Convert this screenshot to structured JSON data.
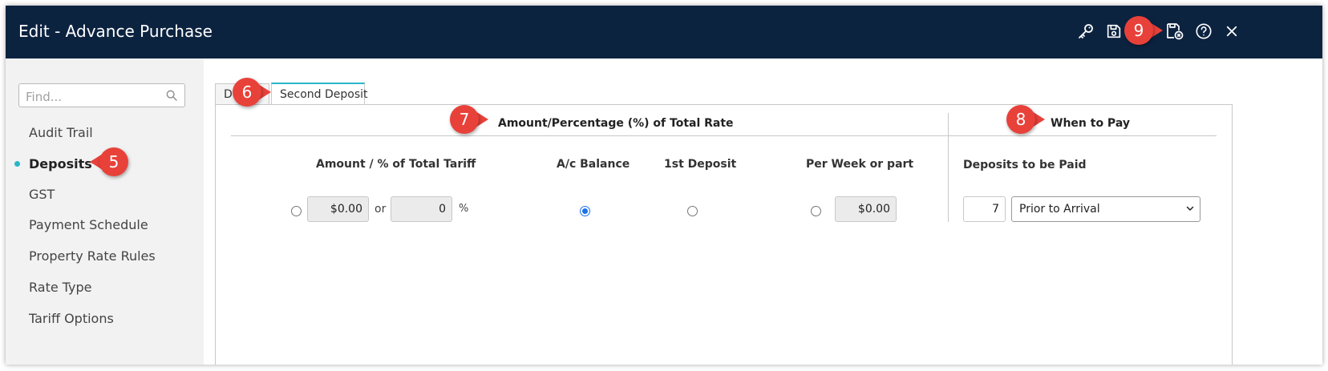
{
  "window": {
    "title": "Edit - Advance Purchase"
  },
  "toolbar": {
    "icons": [
      "key-icon",
      "save-icon",
      "save-close-icon",
      "help-icon",
      "close-icon"
    ]
  },
  "sidebar": {
    "search": {
      "placeholder": "Find...",
      "value": ""
    },
    "items": [
      {
        "label": "Audit Trail",
        "active": false
      },
      {
        "label": "Deposits",
        "active": true
      },
      {
        "label": "GST",
        "active": false
      },
      {
        "label": "Payment Schedule",
        "active": false
      },
      {
        "label": "Property Rate Rules",
        "active": false
      },
      {
        "label": "Rate Type",
        "active": false
      },
      {
        "label": "Tariff Options",
        "active": false
      }
    ]
  },
  "tabs": [
    {
      "label": "D",
      "active": false
    },
    {
      "label": "Second Deposit",
      "active": true
    }
  ],
  "panel": {
    "section_amount": {
      "title": "Amount/Percentage (%) of Total Rate"
    },
    "section_when": {
      "title": "When to Pay"
    },
    "columns": {
      "amount_pct": "Amount / % of Total Tariff",
      "ac_balance": "A/c Balance",
      "first_deposit": "1st Deposit",
      "per_week": "Per Week or part",
      "deposits_to_be_paid": "Deposits to be Paid"
    },
    "fields": {
      "amount_value": "$0.00",
      "or_text": "or",
      "percent_value": "0",
      "percent_symbol": "%",
      "per_week_value": "$0.00",
      "days_value": "7",
      "when_select": {
        "selected": "Prior to Arrival"
      }
    },
    "selected_option": "ac_balance"
  },
  "annotations": [
    "5",
    "6",
    "7",
    "8",
    "9"
  ],
  "colors": {
    "titlebar": "#0c2340",
    "accent": "#29b6c8",
    "marker": "#e8413a",
    "radio_checked": "#1a73e8"
  }
}
